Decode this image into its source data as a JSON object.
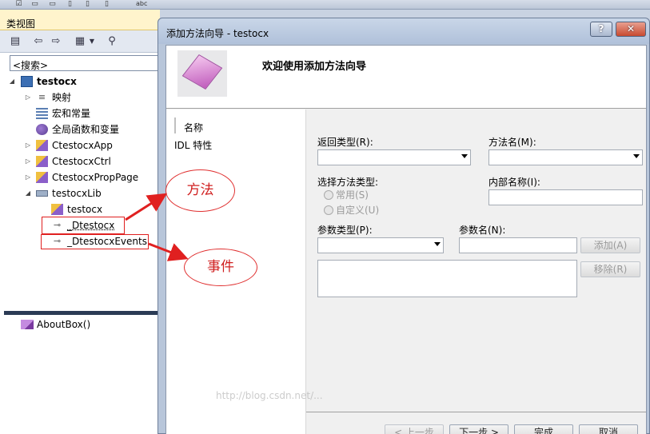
{
  "topbar": {
    "abc_label": "abc"
  },
  "classview": {
    "title": "类视图",
    "search_placeholder": "<搜索>",
    "tree": [
      {
        "label": "testocx",
        "bold": true
      },
      {
        "label": "映射"
      },
      {
        "label": "宏和常量"
      },
      {
        "label": "全局函数和变量"
      },
      {
        "label": "CtestocxApp"
      },
      {
        "label": "CtestocxCtrl"
      },
      {
        "label": "CtestocxPropPage"
      },
      {
        "label": "testocxLib"
      },
      {
        "label": "testocx"
      },
      {
        "label": "_Dtestocx"
      },
      {
        "label": "_DtestocxEvents"
      }
    ],
    "member": "AboutBox()"
  },
  "annotations": {
    "method": "方法",
    "event": "事件"
  },
  "dialog": {
    "title": "添加方法向导 - testocx",
    "help": "?",
    "close": "✕",
    "welcome": "欢迎使用添加方法向导",
    "nav": [
      "名称",
      "IDL 特性"
    ],
    "return_type_label": "返回类型(R):",
    "method_name_label": "方法名(M):",
    "method_type_label": "选择方法类型:",
    "radio_common": "常用(S)",
    "radio_custom": "自定义(U)",
    "internal_name_label": "内部名称(I):",
    "param_type_label": "参数类型(P):",
    "param_name_label": "参数名(N):",
    "add_button": "添加(A)",
    "remove_button": "移除(R)",
    "prev_button": "< 上一步",
    "next_button": "下一步 >",
    "finish_button": "完成",
    "cancel_button": "取消"
  },
  "watermark": "http://blog.csdn.net/..."
}
